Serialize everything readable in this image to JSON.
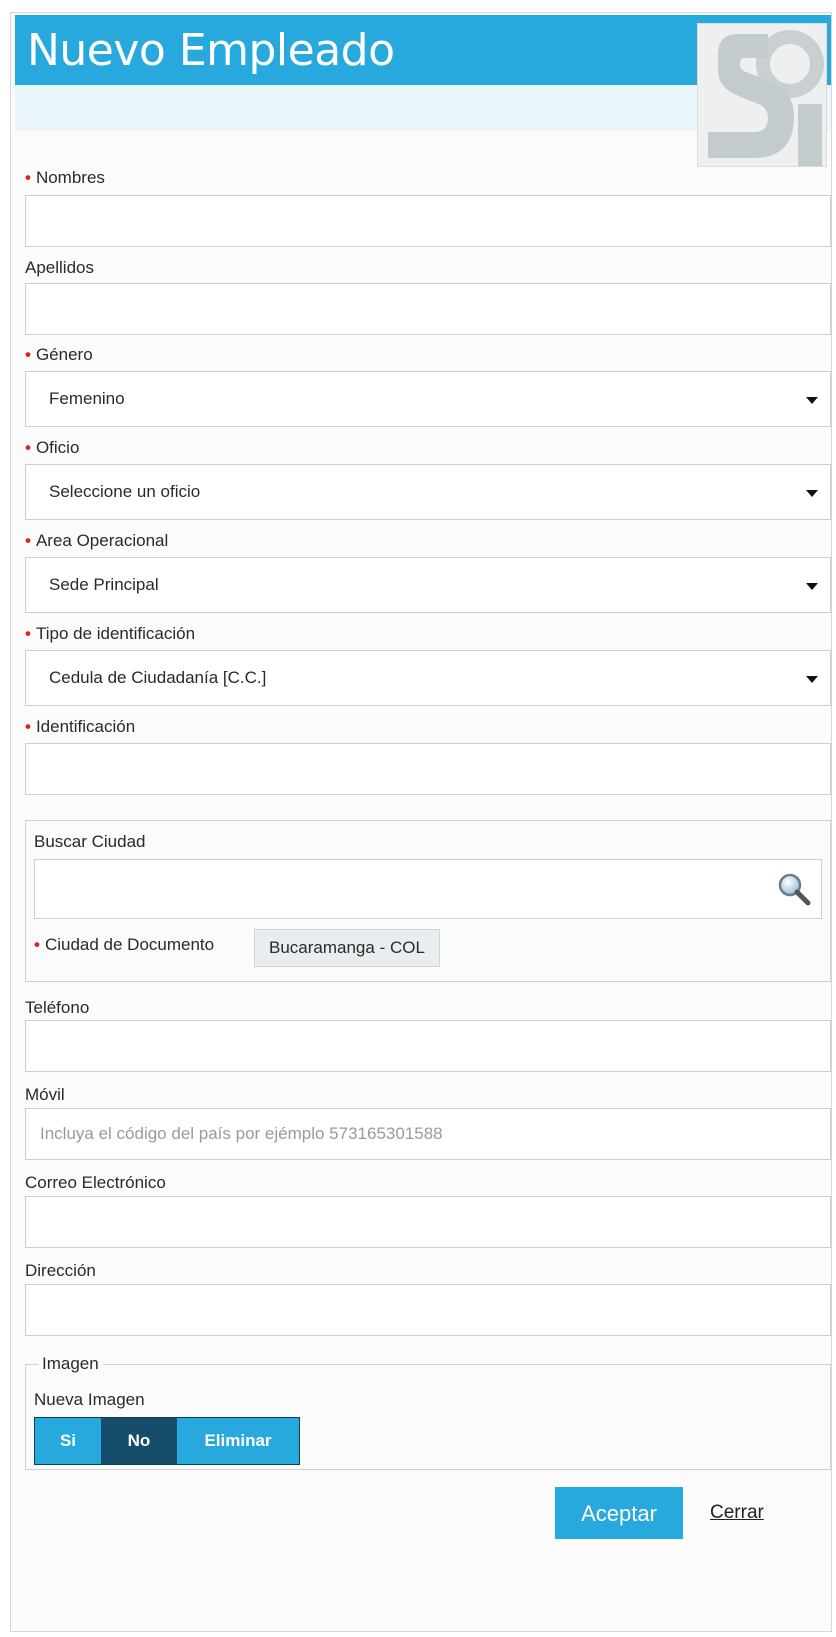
{
  "dialog": {
    "title": "Nuevo Empleado",
    "logo_icon": "sj-logo"
  },
  "fields": {
    "nombres": {
      "label": "Nombres",
      "required": true,
      "value": ""
    },
    "apellidos": {
      "label": "Apellidos",
      "required": false,
      "value": ""
    },
    "genero": {
      "label": "Género",
      "required": true,
      "value": "Femenino"
    },
    "oficio": {
      "label": "Oficio",
      "required": true,
      "value": "Seleccione un oficio"
    },
    "area": {
      "label": "Area Operacional",
      "required": true,
      "value": "Sede Principal"
    },
    "tipo_id": {
      "label": "Tipo de identificación",
      "required": true,
      "value": "Cedula de Ciudadanía [C.C.]"
    },
    "identificacion": {
      "label": "Identificación",
      "required": true,
      "value": ""
    },
    "buscar_ciudad": {
      "label": "Buscar Ciudad",
      "value": "",
      "icon": "search-icon"
    },
    "ciudad_documento": {
      "label": "Ciudad de Documento",
      "required": true,
      "value": "Bucaramanga - COL"
    },
    "telefono": {
      "label": "Teléfono",
      "value": ""
    },
    "movil": {
      "label": "Móvil",
      "value": "",
      "placeholder": "Incluya el código del país por ejémplo 573165301588"
    },
    "correo": {
      "label": "Correo Electrónico",
      "value": ""
    },
    "direccion": {
      "label": "Dirección",
      "value": ""
    }
  },
  "imagen": {
    "legend": "Imagen",
    "label": "Nueva Imagen",
    "options": [
      "Si",
      "No",
      "Eliminar"
    ],
    "selected": "No"
  },
  "actions": {
    "accept": "Aceptar",
    "close": "Cerrar"
  },
  "colors": {
    "primary": "#27a9de",
    "selected_segment": "#154d6b",
    "required_marker": "#e02020"
  }
}
